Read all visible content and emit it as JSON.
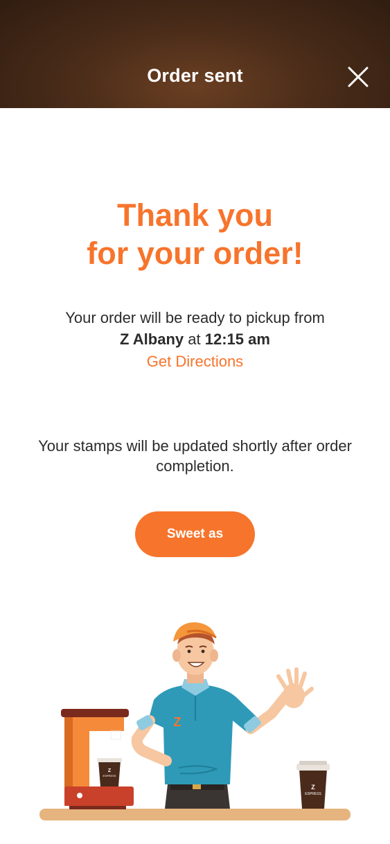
{
  "header": {
    "title": "Order sent"
  },
  "main": {
    "thank_line1": "Thank you",
    "thank_line2": "for your order!",
    "ready_text": "Your order will be ready to pickup from",
    "store_name": "Z Albany",
    "at_text": "at",
    "pickup_time": "12:15 am",
    "directions_link": "Get Directions",
    "stamps_text": "Your stamps will be updated shortly after order completion.",
    "button_label": "Sweet as"
  },
  "illustration": {
    "shirt_logo": "Z",
    "cup_logo": "Z",
    "cup_brand": "ESPRESS"
  },
  "colors": {
    "accent": "#f7742c",
    "header_brown": "#4a2c19",
    "text": "#2b2b2b"
  }
}
